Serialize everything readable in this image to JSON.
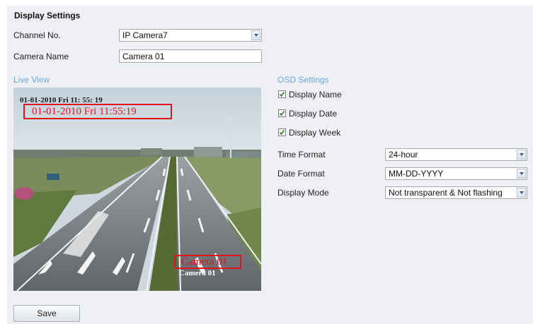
{
  "title": "Display Settings",
  "channel": {
    "label": "Channel No.",
    "value": "IP Camera7"
  },
  "camera_name": {
    "label": "Camera Name",
    "value": "Camera 01"
  },
  "live_view": {
    "section_label": "Live View",
    "osd_date_plain": "01-01-2010   Fri   11:  55:  19",
    "osd_date_boxed": "01-01-2010   Fri   11:55:19",
    "osd_name_plain": "Camera 01",
    "osd_name_boxed": "Camera 01"
  },
  "osd_settings": {
    "section_label": "OSD Settings",
    "checkboxes": [
      {
        "label": "Display Name",
        "checked": true
      },
      {
        "label": "Display Date",
        "checked": true
      },
      {
        "label": "Display Week",
        "checked": true
      }
    ],
    "time_format": {
      "label": "Time Format",
      "value": "24-hour"
    },
    "date_format": {
      "label": "Date Format",
      "value": "MM-DD-YYYY"
    },
    "display_mode": {
      "label": "Display Mode",
      "value": "Not transparent & Not flashing"
    }
  },
  "save_label": "Save",
  "colors": {
    "section": "#6aa7de",
    "osd_red": "#e3141c",
    "panel_bg": "#eef0f3"
  }
}
